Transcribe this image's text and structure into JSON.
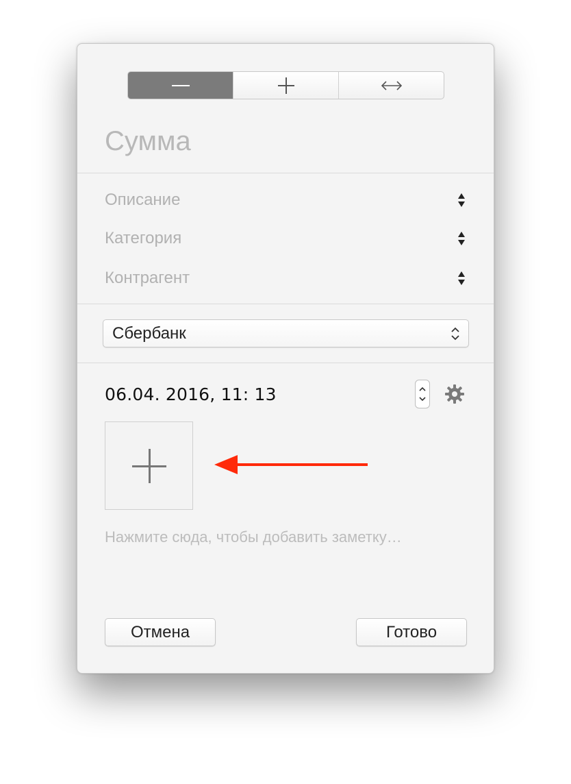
{
  "segmented": {
    "segments": [
      {
        "icon": "minus-icon",
        "active": true
      },
      {
        "icon": "plus-icon",
        "active": false
      },
      {
        "icon": "left-right-arrow-icon",
        "active": false
      }
    ]
  },
  "amount": {
    "placeholder": "Сумма"
  },
  "fields": [
    {
      "label": "Описание",
      "icon": "up-down-arrows-icon"
    },
    {
      "label": "Категория",
      "icon": "up-down-arrows-icon"
    },
    {
      "label": "Контрагент",
      "icon": "up-down-arrows-icon"
    }
  ],
  "account": {
    "selected": "Сбербанк",
    "icon": "chevron-up-down-icon"
  },
  "datetime": {
    "value": "06.04. 2016,  11: 13",
    "stepper_icon": "date-stepper-icon",
    "settings_icon": "gear-icon"
  },
  "attachment": {
    "icon": "plus-icon"
  },
  "annotation": {
    "icon": "red-arrow-left-icon",
    "color": "#ff2a0a"
  },
  "note": {
    "placeholder": "Нажмите сюда, чтобы добавить заметку…"
  },
  "actions": {
    "cancel_label": "Отмена",
    "done_label": "Готово"
  },
  "colors": {
    "active_segment": "#7b7b7b",
    "window_bg": "#f4f4f4"
  }
}
